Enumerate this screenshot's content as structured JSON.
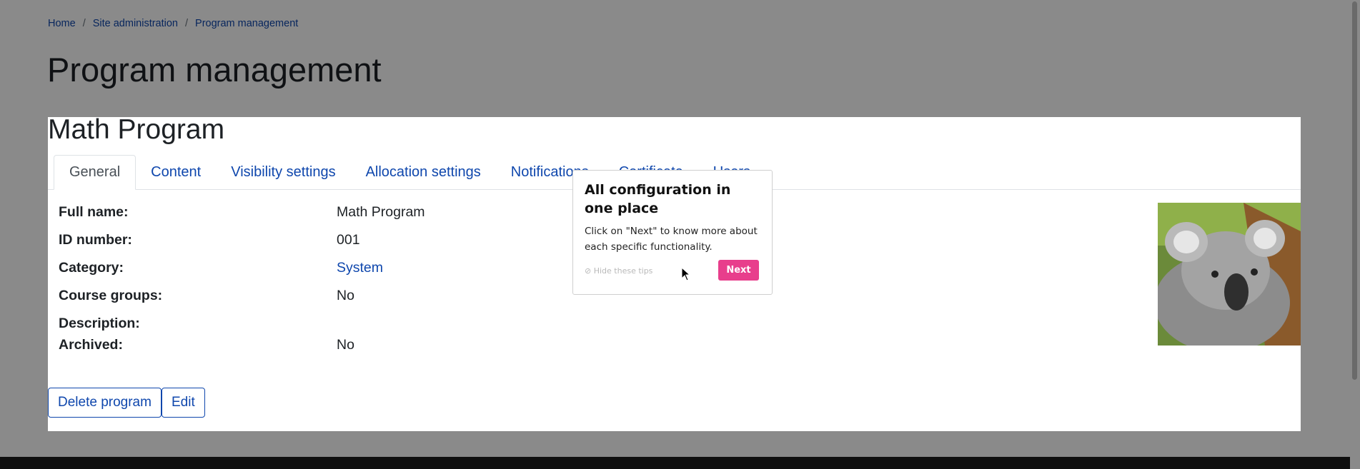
{
  "breadcrumb": {
    "items": [
      "Home",
      "Site administration",
      "Program management"
    ],
    "separator": "/"
  },
  "page_title": "Program management",
  "program": {
    "title": "Math Program",
    "tabs": [
      "General",
      "Content",
      "Visibility settings",
      "Allocation settings",
      "Notifications",
      "Certificate",
      "Users"
    ],
    "active_tab": "General",
    "fields": [
      {
        "label": "Full name:",
        "value": "Math Program"
      },
      {
        "label": "ID number:",
        "value": "001"
      },
      {
        "label": "Category:",
        "value": "System"
      },
      {
        "label": "Course groups:",
        "value": "No"
      },
      {
        "label": "Description:",
        "value": ""
      },
      {
        "label": "Archived:",
        "value": "No"
      }
    ],
    "buttons": {
      "delete": "Delete program",
      "edit": "Edit"
    },
    "image": "koala-image"
  },
  "tour": {
    "title": "All configuration in one place",
    "body": "Click on \"Next\" to know more about each specific functionality.",
    "hide": "⊘ Hide these tips",
    "next": "Next"
  },
  "colors": {
    "link": "#0f47ad",
    "accent_button": "#e83e8c",
    "overlay": "rgba(0,0,0,0.46)",
    "footer": "#1d1d1d"
  }
}
